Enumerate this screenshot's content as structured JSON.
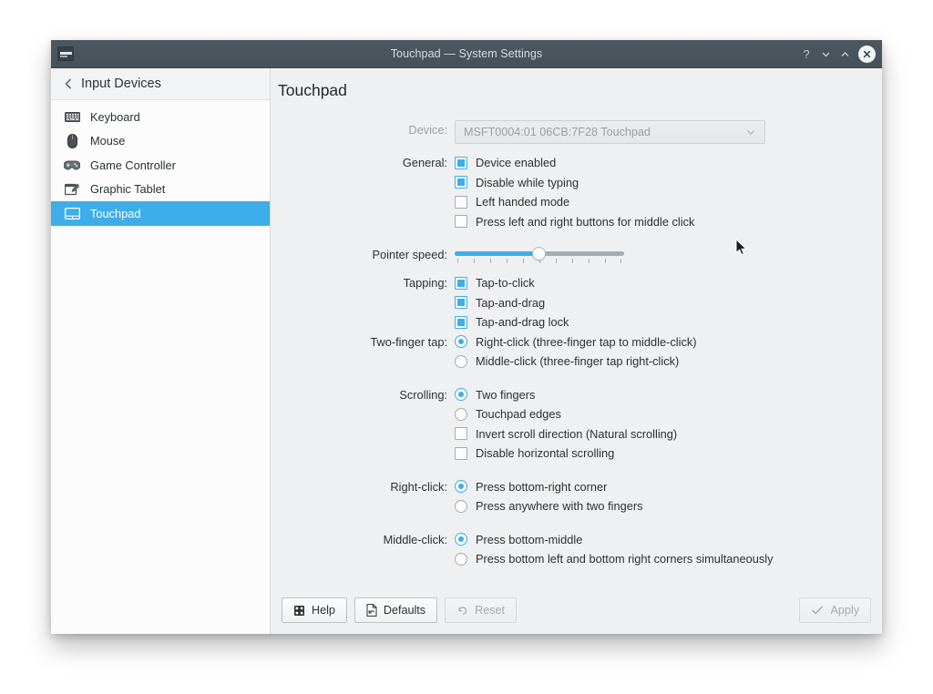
{
  "window": {
    "title": "Touchpad — System Settings",
    "icon": "system-settings-icon",
    "buttons": {
      "help": "?",
      "shade": "⌄",
      "maximize": "⌃",
      "close": "✕"
    }
  },
  "sidebar": {
    "header": {
      "back_icon": "‹",
      "label": "Input Devices"
    },
    "items": [
      {
        "label": "Keyboard",
        "icon": "keyboard-icon",
        "selected": false
      },
      {
        "label": "Mouse",
        "icon": "mouse-icon",
        "selected": false
      },
      {
        "label": "Game Controller",
        "icon": "gamepad-icon",
        "selected": false
      },
      {
        "label": "Graphic Tablet",
        "icon": "graphic-tablet-icon",
        "selected": false
      },
      {
        "label": "Touchpad",
        "icon": "touchpad-icon",
        "selected": true
      }
    ]
  },
  "main": {
    "page_title": "Touchpad",
    "device": {
      "label": "Device:",
      "value": "MSFT0004:01 06CB:7F28 Touchpad",
      "chevron": "⌄",
      "disabled": true
    },
    "general": {
      "label": "General:",
      "options": [
        {
          "label": "Device enabled",
          "checked": true
        },
        {
          "label": "Disable while typing",
          "checked": true
        },
        {
          "label": "Left handed mode",
          "checked": false
        },
        {
          "label": "Press left and right buttons for middle click",
          "checked": false
        }
      ]
    },
    "pointer_speed": {
      "label": "Pointer speed:",
      "value_percent": 49,
      "ticks": 11
    },
    "tapping": {
      "label": "Tapping:",
      "options": [
        {
          "label": "Tap-to-click",
          "checked": true
        },
        {
          "label": "Tap-and-drag",
          "checked": true
        },
        {
          "label": "Tap-and-drag lock",
          "checked": true
        }
      ]
    },
    "two_finger_tap": {
      "label": "Two-finger tap:",
      "options": [
        {
          "label": "Right-click (three-finger tap to middle-click)",
          "checked": true
        },
        {
          "label": "Middle-click (three-finger tap right-click)",
          "checked": false
        }
      ]
    },
    "scrolling": {
      "label": "Scrolling:",
      "radios": [
        {
          "label": "Two fingers",
          "checked": true
        },
        {
          "label": "Touchpad edges",
          "checked": false
        }
      ],
      "checkboxes": [
        {
          "label": "Invert scroll direction (Natural scrolling)",
          "checked": false
        },
        {
          "label": "Disable horizontal scrolling",
          "checked": false
        }
      ]
    },
    "right_click": {
      "label": "Right-click:",
      "options": [
        {
          "label": "Press bottom-right corner",
          "checked": true
        },
        {
          "label": "Press anywhere with two fingers",
          "checked": false
        }
      ]
    },
    "middle_click": {
      "label": "Middle-click:",
      "options": [
        {
          "label": "Press bottom-middle",
          "checked": true
        },
        {
          "label": "Press bottom left and bottom right corners simultaneously",
          "checked": false
        }
      ]
    }
  },
  "footer": {
    "help": {
      "label": "Help",
      "icon": "help-icon",
      "disabled": false
    },
    "defaults": {
      "label": "Defaults",
      "icon": "document-revert-icon",
      "disabled": false
    },
    "reset": {
      "label": "Reset",
      "icon": "undo-arrow-icon",
      "disabled": true
    },
    "apply": {
      "label": "Apply",
      "icon": "checkmark-icon",
      "disabled": true
    }
  },
  "colors": {
    "accent": "#3daee9",
    "titlebar": "#4b555e",
    "panel_bg": "#eff0f1",
    "sidebar_bg": "#fcfcfc"
  }
}
